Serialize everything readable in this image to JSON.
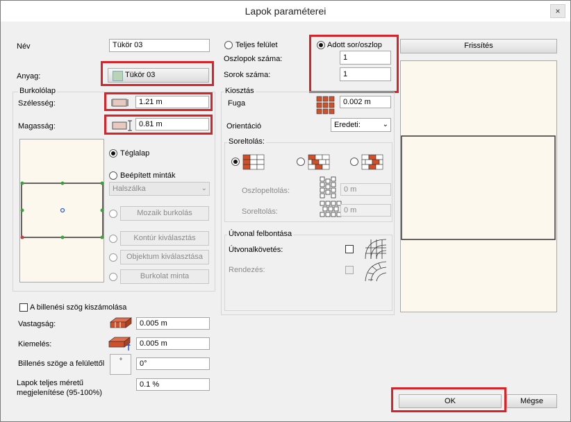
{
  "window": {
    "title": "Lapok paraméterei",
    "close_glyph": "×"
  },
  "left": {
    "name_label": "Név",
    "name_value": "Tükör 03",
    "material_label": "Anyag:",
    "material_button": "Tükör 03",
    "tile_group": "Burkolólap",
    "width_label": "Szélesség:",
    "width_value": "1.21 m",
    "height_label": "Magasság:",
    "height_value": "0.81 m",
    "shape_options": {
      "rectangle": "Téglalap",
      "builtin": "Beépített minták",
      "builtin_select": "Halszálka",
      "mosaic": "Mozaik burkolás",
      "contour": "Kontúr kiválasztás",
      "object": "Objektum kiválasztása",
      "pattern": "Burkolat minta"
    },
    "tilt_checkbox": "A billenési szög kiszámolása",
    "thickness_label": "Vastagság:",
    "thickness_value": "0.005 m",
    "offset_label": "Kiemelés:",
    "offset_value": "0.005 m",
    "tilt_angle_label": "Billenés szöge a felülettől",
    "tilt_angle_value": "0°",
    "full_size_label_1": "Lapok teljes méretű",
    "full_size_label_2": "megjelenítése (95-100%)",
    "full_size_value": "0.1 %"
  },
  "middle": {
    "full_surface": "Teljes felület",
    "row_col": "Adott sor/oszlop",
    "columns_label": "Oszlopok száma:",
    "columns_value": "1",
    "rows_label": "Sorok száma:",
    "rows_value": "1",
    "distribution_group": "Kiosztás",
    "joint_label": "Fuga",
    "joint_value": "0.002 m",
    "orientation_label": "Orientáció",
    "orientation_value": "Eredeti:",
    "row_offset_group": "Soreltolás:",
    "column_offset_label": "Oszlopeltolás:",
    "column_offset_value": "0 m",
    "row_offset_label": "Soreltolás:",
    "row_offset_value": "0 m",
    "path_group": "Útvonal felbontása",
    "path_follow_label": "Útvonalkövetés:",
    "arrange_label": "Rendezés:"
  },
  "right": {
    "refresh_button": "Frissítés",
    "ok_button": "OK",
    "cancel_button": "Mégse"
  },
  "colors": {
    "highlight": "#d8232a",
    "preview_bg": "#fdf8ee",
    "brick": "#d0502a",
    "handle": "#3aa23a",
    "center": "#2b5fd9"
  }
}
